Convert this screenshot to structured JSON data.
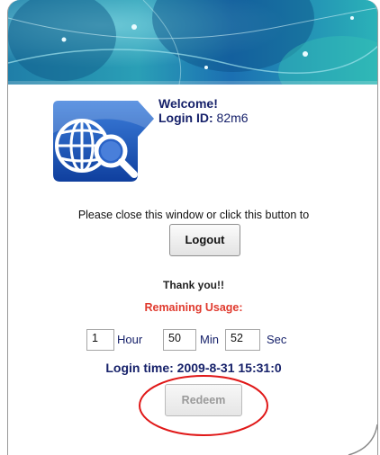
{
  "welcome": {
    "greeting": "Welcome!",
    "login_id_label": "Login ID:",
    "login_id_value": "82m6"
  },
  "message": "Please close this window or click this button to",
  "logout_label": "Logout",
  "thanks": "Thank you!!",
  "remaining_label": "Remaining Usage:",
  "usage": {
    "hour_value": "1",
    "hour_label": "Hour",
    "min_value": "50",
    "min_label": "Min",
    "sec_value": "52",
    "sec_label": "Sec"
  },
  "login_time": "Login time: 2009-8-31 15:31:0",
  "redeem_label": "Redeem",
  "colors": {
    "text_navy": "#16216a",
    "remaining_red": "#e03a2e",
    "annotation_red": "#e01818"
  },
  "icons": {
    "logo": "globe-magnifier-icon"
  }
}
